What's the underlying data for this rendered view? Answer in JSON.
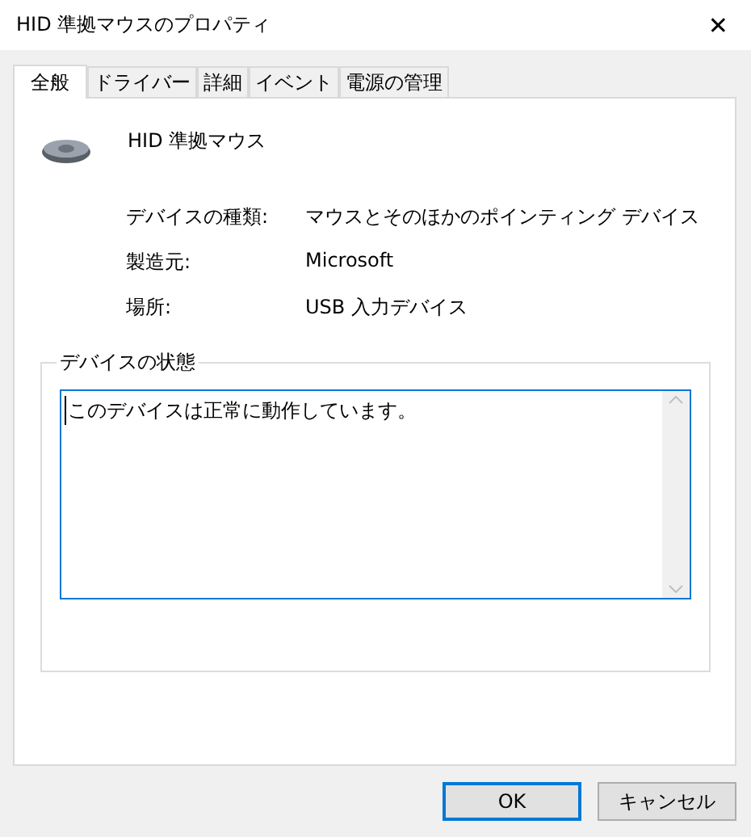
{
  "window": {
    "title": "HID 準拠マウスのプロパティ",
    "close": "✕"
  },
  "tabs": [
    {
      "label": "全般",
      "selected": true
    },
    {
      "label": "ドライバー",
      "selected": false
    },
    {
      "label": "詳細",
      "selected": false
    },
    {
      "label": "イベント",
      "selected": false
    },
    {
      "label": "電源の管理",
      "selected": false
    }
  ],
  "device": {
    "name": "HID 準拠マウス"
  },
  "properties": [
    {
      "label": "デバイスの種類:",
      "value": "マウスとそのほかのポインティング デバイス"
    },
    {
      "label": "製造元:",
      "value": "Microsoft"
    },
    {
      "label": "場所:",
      "value": "USB 入力デバイス"
    }
  ],
  "status": {
    "legend": "デバイスの状態",
    "text": "このデバイスは正常に動作しています。"
  },
  "buttons": [
    {
      "label": "OK",
      "default": true
    },
    {
      "label": "キャンセル",
      "default": false
    }
  ]
}
